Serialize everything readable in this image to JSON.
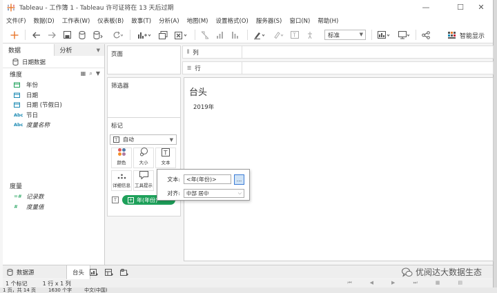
{
  "window": {
    "title": "Tableau - 工作簿 1 - Tableau 许可证将在 13 天后过期",
    "minimize": "—",
    "maximize": "☐",
    "close": "✕"
  },
  "menu": [
    "文件(F)",
    "数据(D)",
    "工作表(W)",
    "仪表板(B)",
    "故事(T)",
    "分析(A)",
    "地图(M)",
    "设置格式(O)",
    "服务器(S)",
    "窗口(N)",
    "帮助(H)"
  ],
  "toolbar": {
    "format_select": "标准",
    "smart_show": "智能显示"
  },
  "data_pane": {
    "tab_data": "数据",
    "tab_analysis": "分析",
    "datasource": "日期数据",
    "dimensions_header": "维度",
    "dimensions": [
      {
        "icon": "date-icon",
        "name": "年份",
        "italic": false
      },
      {
        "icon": "calendar-icon",
        "name": "日期",
        "italic": false
      },
      {
        "icon": "calendar-icon",
        "name": "日期 (节假日)",
        "italic": false
      },
      {
        "icon": "abc-icon",
        "name": "节日",
        "italic": false
      },
      {
        "icon": "abc-icon",
        "name": "度量名称",
        "italic": true
      }
    ],
    "measures_header": "度量",
    "measures": [
      {
        "icon": "measure-icon",
        "name": "记录数",
        "italic": true
      },
      {
        "icon": "measure-icon",
        "name": "度量值",
        "italic": true
      }
    ]
  },
  "cards": {
    "pages": "页面",
    "filters": "筛选器",
    "marks": "标记",
    "mark_type": "自动",
    "buttons": {
      "color": "颜色",
      "size": "大小",
      "text": "文本",
      "detail": "详细信息",
      "tooltip": "工具提示"
    },
    "pill": "年(年份)"
  },
  "shelves": {
    "columns": "列",
    "rows": "行"
  },
  "view": {
    "title": "台头",
    "value": "2019年"
  },
  "popup": {
    "text_label": "文本:",
    "text_value": "<年(年份)>",
    "dots": "...",
    "align_label": "对齐:",
    "align_value": "中部 居中"
  },
  "sheet_tabs": {
    "datasource": "数据源",
    "sheet": "台头"
  },
  "watermark": "优阅达大数据生态",
  "status": {
    "marks": "1 个标记",
    "rows_cols": "1 行 x 1 列"
  },
  "taskbar": [
    "1 页，共 14 页",
    "1630 个字",
    "中文(中国)"
  ]
}
